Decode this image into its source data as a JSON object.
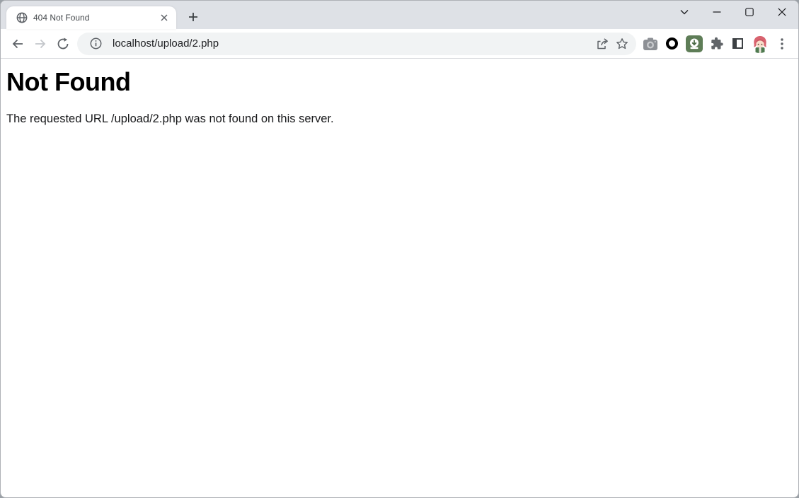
{
  "tab_bar": {
    "tab": {
      "title": "404 Not Found",
      "favicon": "globe-icon",
      "close": "close-icon"
    },
    "new_tab_icon": "plus-icon"
  },
  "window_controls": {
    "tab_search": "chevron-down-icon",
    "minimize": "minimize-icon",
    "maximize": "maximize-icon",
    "close": "close-icon"
  },
  "toolbar": {
    "back_icon": "arrow-left-icon",
    "forward_icon": "arrow-right-icon",
    "reload_icon": "reload-icon",
    "omnibox": {
      "site_info_icon": "info-icon",
      "url": "localhost/upload/2.php",
      "share_icon": "share-icon",
      "bookmark_icon": "star-icon"
    },
    "extensions": [
      "camera-icon",
      "ring-icon",
      "download-icon",
      "puzzle-icon",
      "sidebar-icon"
    ],
    "profile": "avatar",
    "menu_icon": "kebab-menu-icon"
  },
  "content": {
    "heading": "Not Found",
    "message": "The requested URL /upload/2.php was not found on this server."
  },
  "colors": {
    "tab_strip_bg": "#dee1e6",
    "toolbar_bg": "#ffffff",
    "omnibox_bg": "#f1f3f4",
    "icon_gray": "#5f6368",
    "disabled_gray": "#c4c7cb",
    "text_dark": "#202124",
    "extension_green": "#5e7d57"
  }
}
